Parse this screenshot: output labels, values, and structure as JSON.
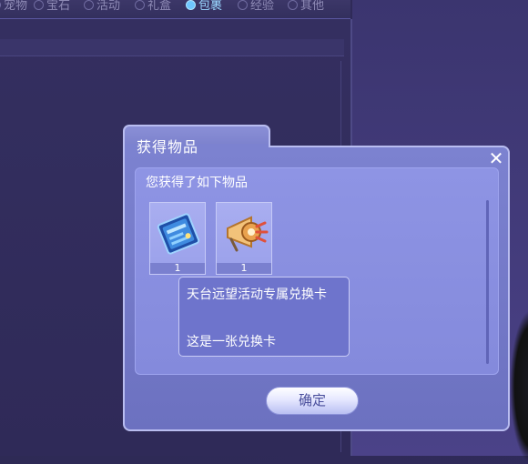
{
  "tabs": [
    {
      "label": "宠物",
      "active": false
    },
    {
      "label": "宝石",
      "active": false
    },
    {
      "label": "活动",
      "active": false
    },
    {
      "label": "礼盒",
      "active": false
    },
    {
      "label": "包裹",
      "active": true
    },
    {
      "label": "经验",
      "active": false
    },
    {
      "label": "其他",
      "active": false
    }
  ],
  "dialog": {
    "title": "获得物品",
    "message": "您获得了如下物品",
    "close_icon": "close-icon",
    "confirm_label": "确定"
  },
  "items": [
    {
      "name": "exchange-card",
      "icon": "card-icon",
      "count": "1"
    },
    {
      "name": "horn",
      "icon": "horn-icon",
      "count": "1"
    }
  ],
  "tooltip": {
    "title": "天台远望活动专属兑换卡",
    "description": "这是一张兑换卡"
  },
  "colors": {
    "dialog": "#7c82d0",
    "accent_tab": "#6fc6ff",
    "background": "#2e2a55"
  }
}
